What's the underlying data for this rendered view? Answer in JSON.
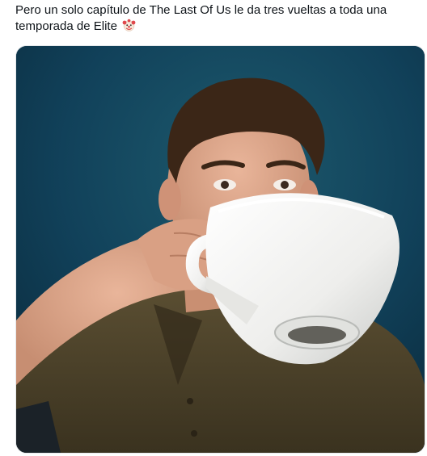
{
  "tweet": {
    "text": "Pero un solo capítulo de The Last Of Us le da tres vueltas a toda una temporada de Elite",
    "emoji": "clown-face-icon"
  },
  "media": {
    "type": "photo",
    "subject": "man drinking from an oversized white teacup",
    "background_color": "#0d3346",
    "cup_color": "#f4f4f2",
    "shirt_color": "#4b4128"
  }
}
